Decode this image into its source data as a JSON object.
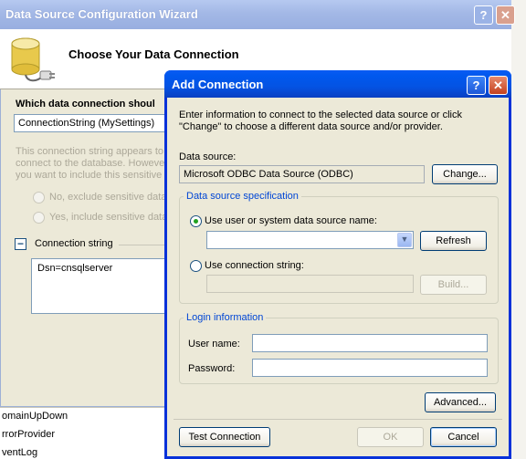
{
  "background": {
    "toolbox_items": [
      "omainUpDown",
      "rrorProvider",
      "ventLog"
    ]
  },
  "wizard": {
    "title": "Data Source Configuration Wizard",
    "header_title": "Choose Your Data Connection",
    "question_label": "Which data connection shoul",
    "connection_value": "ConnectionString (MySettings)",
    "info_text_lines": [
      "This connection string appears to",
      "connect to the database. Howeve",
      "you want to include this sensitive"
    ],
    "radio_exclude": "No, exclude sensitive data",
    "radio_include": "Yes, include sensitive data",
    "connection_string_label": "Connection string",
    "connection_string_value": "Dsn=cnsqlserver",
    "help_glyph": "?",
    "close_glyph": "✕"
  },
  "dialog": {
    "title": "Add Connection",
    "intro_line1": "Enter information to connect to the selected data source or click",
    "intro_line2": "\"Change\" to choose a different data source and/or provider.",
    "data_source_label": "Data source:",
    "data_source_value": "Microsoft ODBC Data Source (ODBC)",
    "change_button": "Change...",
    "ds_spec_legend": "Data source specification",
    "radio_dsn_label": "Use user or system data source name:",
    "dsn_value": "",
    "refresh_button": "Refresh",
    "radio_connstr_label": "Use connection string:",
    "connstr_value": "",
    "build_button": "Build...",
    "login_legend": "Login information",
    "username_label": "User name:",
    "username_value": "",
    "password_label": "Password:",
    "password_value": "",
    "advanced_button": "Advanced...",
    "test_button": "Test Connection",
    "ok_button": "OK",
    "cancel_button": "Cancel",
    "help_glyph": "?",
    "close_glyph": "✕"
  },
  "colors": {
    "xp_titlebar_active": "#0453e3",
    "xp_titlebar_inactive": "#a3b8e6",
    "legend_blue": "#0046d5",
    "window_face": "#ece9d8"
  }
}
